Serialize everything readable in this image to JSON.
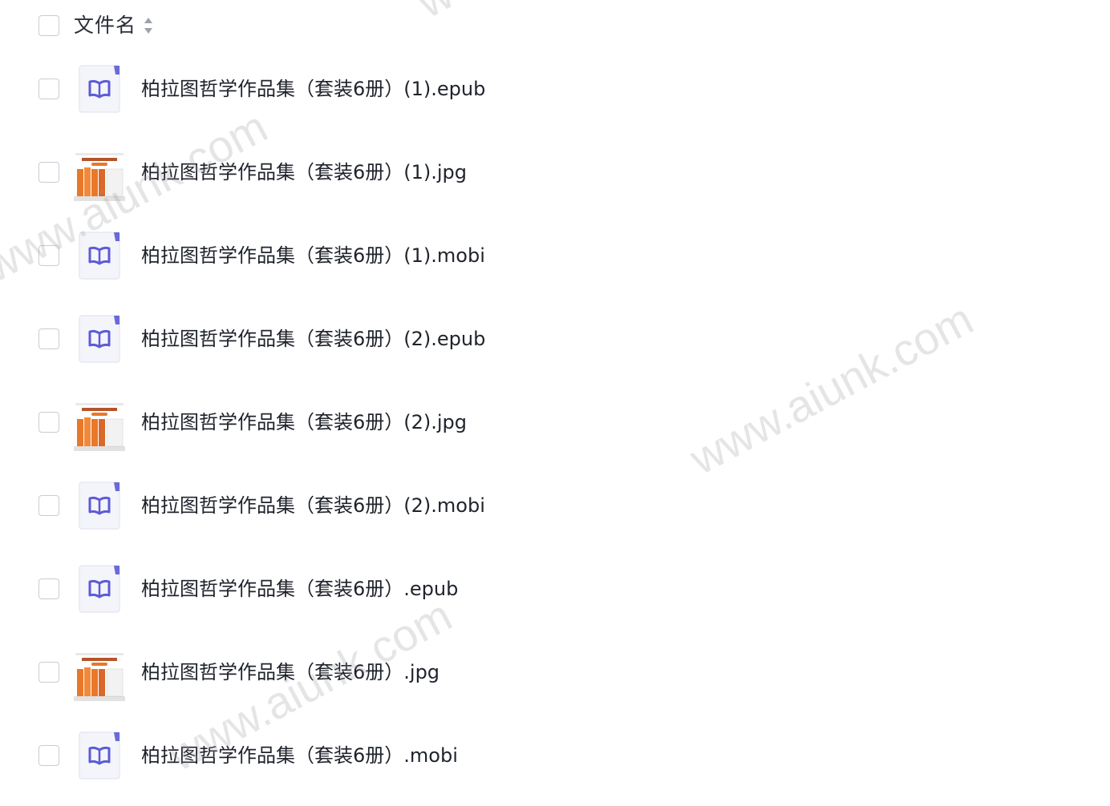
{
  "header": {
    "column_label": "文件名"
  },
  "files": [
    {
      "name": "柏拉图哲学作品集（套装6册）(1).epub",
      "type": "ebook-icon"
    },
    {
      "name": "柏拉图哲学作品集（套装6册）(1).jpg",
      "type": "image-thumbnail"
    },
    {
      "name": "柏拉图哲学作品集（套装6册）(1).mobi",
      "type": "ebook-icon"
    },
    {
      "name": "柏拉图哲学作品集（套装6册）(2).epub",
      "type": "ebook-icon"
    },
    {
      "name": "柏拉图哲学作品集（套装6册）(2).jpg",
      "type": "image-thumbnail"
    },
    {
      "name": "柏拉图哲学作品集（套装6册）(2).mobi",
      "type": "ebook-icon"
    },
    {
      "name": "柏拉图哲学作品集（套装6册）.epub",
      "type": "ebook-icon"
    },
    {
      "name": "柏拉图哲学作品集（套装6册）.jpg",
      "type": "image-thumbnail"
    },
    {
      "name": "柏拉图哲学作品集（套装6册）.mobi",
      "type": "ebook-icon"
    }
  ],
  "thumbnail_text": "柏拉图哲学作品集",
  "watermark_text": "www.aiunk.com",
  "colors": {
    "ebook_icon": "#5b5bd6",
    "ebook_bg": "#f4f4fb",
    "cover_orange": "#e8782a"
  }
}
